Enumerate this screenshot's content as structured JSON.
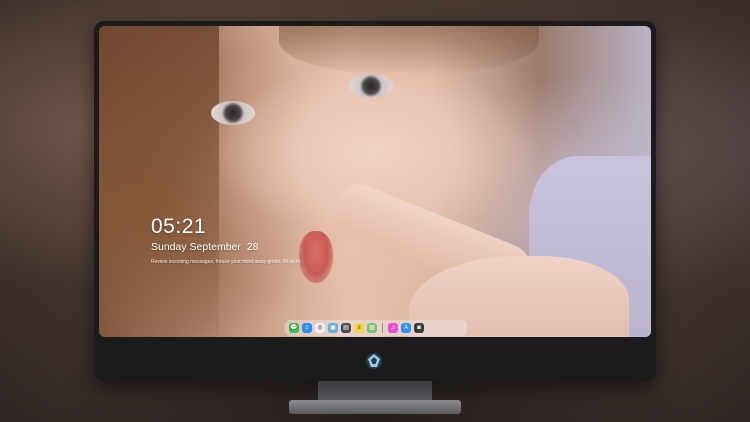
{
  "lockscreen": {
    "time": "05:21",
    "date": "Sunday September  28",
    "notice": "Review incoming messages, freeze your mind away grade, fill up to"
  },
  "dock": {
    "apps": [
      {
        "name": "messages-icon",
        "color": "#36c24a",
        "glyph": "💬"
      },
      {
        "name": "finder-icon",
        "color": "#2d8cf0",
        "glyph": "☺"
      },
      {
        "name": "safari-icon",
        "color": "#f0f0f0",
        "glyph": "◎"
      },
      {
        "name": "preview-icon",
        "color": "#6aa9d8",
        "glyph": "▣"
      },
      {
        "name": "clapper-icon",
        "color": "#4a4a50",
        "glyph": "▤"
      },
      {
        "name": "notes-icon",
        "color": "#f7d44a",
        "glyph": "≡"
      },
      {
        "name": "photos-icon",
        "color": "#7fbf6a",
        "glyph": "▨"
      }
    ],
    "apps_right": [
      {
        "name": "itunes-icon",
        "color": "#e351d1",
        "glyph": "♫"
      },
      {
        "name": "app-store-icon",
        "color": "#2f8ef5",
        "glyph": "A"
      },
      {
        "name": "camera-icon",
        "color": "#3a3a3e",
        "glyph": "◙"
      }
    ]
  },
  "colors": {
    "bezel": "#1b1b1d",
    "text": "#ffffff",
    "logo": "#8fd0e8"
  }
}
